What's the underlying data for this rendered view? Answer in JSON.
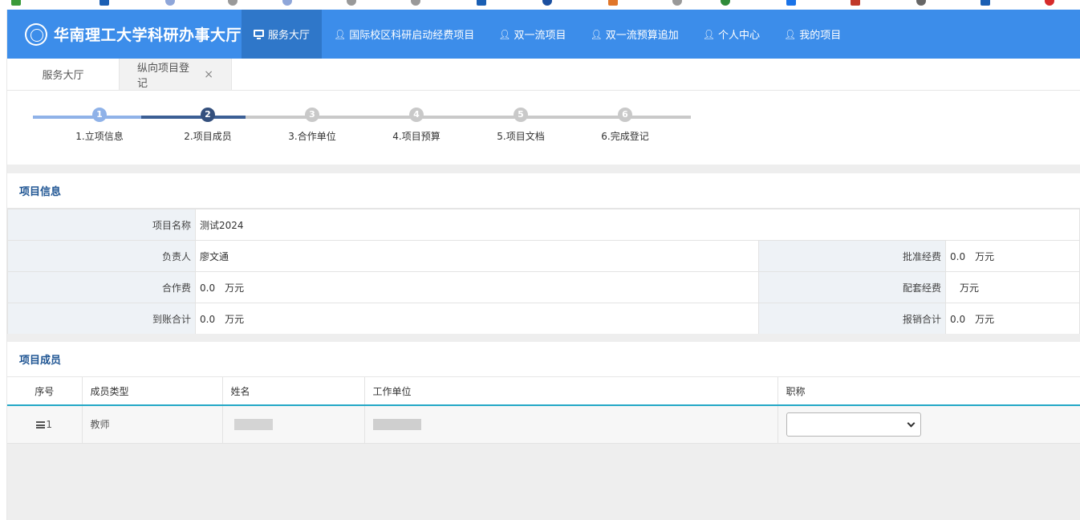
{
  "header": {
    "title": "华南理工大学科研办事大厅",
    "nav": [
      {
        "label": "服务大厅",
        "icon": "monitor-icon",
        "active": true
      },
      {
        "label": "国际校区科研启动经费项目",
        "icon": "user-icon"
      },
      {
        "label": "双一流项目",
        "icon": "user-icon"
      },
      {
        "label": "双一流预算追加",
        "icon": "user-icon"
      },
      {
        "label": "个人中心",
        "icon": "user-icon"
      },
      {
        "label": "我的项目",
        "icon": "user-icon"
      }
    ]
  },
  "tabs": [
    {
      "label": "服务大厅"
    },
    {
      "label": "纵向项目登记",
      "close": "×"
    }
  ],
  "steps": [
    {
      "num": "1",
      "label": "1.立项信息",
      "state": "done"
    },
    {
      "num": "2",
      "label": "2.项目成员",
      "state": "current"
    },
    {
      "num": "3",
      "label": "3.合作单位",
      "state": "todo"
    },
    {
      "num": "4",
      "label": "4.项目预算",
      "state": "todo"
    },
    {
      "num": "5",
      "label": "5.项目文档",
      "state": "todo"
    },
    {
      "num": "6",
      "label": "6.完成登记",
      "state": "todo"
    }
  ],
  "project_info": {
    "section_title": "项目信息",
    "name_label": "项目名称",
    "name_value": "测试2024",
    "leader_label": "负责人",
    "leader_value": "廖文通",
    "approved_label": "批准经费",
    "approved_value": "0.0",
    "coop_label": "合作费",
    "coop_value": "0.0",
    "matching_label": "配套经费",
    "matching_value": "",
    "received_label": "到账合计",
    "received_value": "0.0",
    "reimbursed_label": "报销合计",
    "reimbursed_value": "0.0",
    "unit": "万元"
  },
  "members": {
    "section_title": "项目成员",
    "columns": [
      "序号",
      "成员类型",
      "姓名",
      "工作单位",
      "职称"
    ],
    "rows": [
      {
        "index": "1",
        "type": "教师",
        "name": "",
        "org": "",
        "title": ""
      }
    ]
  },
  "colors": {
    "header_bg": "#3c8dea",
    "nav_active_bg": "#2f77c9",
    "step_done": "#8fb2e8",
    "step_current": "#34507d",
    "step_todo": "#c9c9c9",
    "section_title": "#1f5593",
    "table_header_line": "#24a8c6"
  }
}
